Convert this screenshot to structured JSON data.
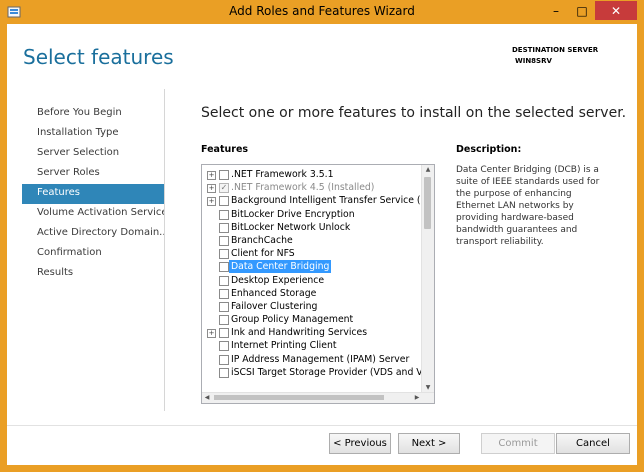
{
  "window": {
    "title": "Add Roles and Features Wizard"
  },
  "header": {
    "page_title": "Select features",
    "destination_label": "DESTINATION SERVER",
    "destination_server": "WIN8SRV"
  },
  "nav": {
    "items": [
      {
        "label": "Before You Begin",
        "active": false
      },
      {
        "label": "Installation Type",
        "active": false
      },
      {
        "label": "Server Selection",
        "active": false
      },
      {
        "label": "Server Roles",
        "active": false
      },
      {
        "label": "Features",
        "active": true
      },
      {
        "label": "Volume Activation Services",
        "active": false
      },
      {
        "label": "Active Directory Domain...",
        "active": false
      },
      {
        "label": "Confirmation",
        "active": false
      },
      {
        "label": "Results",
        "active": false
      }
    ]
  },
  "main": {
    "instruction": "Select one or more features to install on the selected server.",
    "features_label": "Features",
    "description_label": "Description:",
    "description_text": "Data Center Bridging (DCB) is a suite of IEEE standards used for the purpose of enhancing Ethernet LAN networks by providing hardware-based bandwidth guarantees and transport reliability.",
    "features": [
      {
        "label": ".NET Framework 3.5.1",
        "expandable": true,
        "checked": false,
        "installed": false
      },
      {
        "label": ".NET Framework 4.5 (Installed)",
        "expandable": true,
        "checked": true,
        "installed": true
      },
      {
        "label": "Background Intelligent Transfer Service (BIT",
        "expandable": true,
        "checked": false,
        "installed": false
      },
      {
        "label": "BitLocker Drive Encryption",
        "expandable": false,
        "checked": false,
        "installed": false
      },
      {
        "label": "BitLocker Network Unlock",
        "expandable": false,
        "checked": false,
        "installed": false
      },
      {
        "label": "BranchCache",
        "expandable": false,
        "checked": false,
        "installed": false
      },
      {
        "label": "Client for NFS",
        "expandable": false,
        "checked": false,
        "installed": false
      },
      {
        "label": "Data Center Bridging",
        "expandable": false,
        "checked": false,
        "installed": false,
        "selected": true
      },
      {
        "label": "Desktop Experience",
        "expandable": false,
        "checked": false,
        "installed": false
      },
      {
        "label": "Enhanced Storage",
        "expandable": false,
        "checked": false,
        "installed": false
      },
      {
        "label": "Failover Clustering",
        "expandable": false,
        "checked": false,
        "installed": false
      },
      {
        "label": "Group Policy Management",
        "expandable": false,
        "checked": false,
        "installed": false
      },
      {
        "label": "Ink and Handwriting Services",
        "expandable": true,
        "checked": false,
        "installed": false
      },
      {
        "label": "Internet Printing Client",
        "expandable": false,
        "checked": false,
        "installed": false
      },
      {
        "label": "IP Address Management (IPAM) Server",
        "expandable": false,
        "checked": false,
        "installed": false
      },
      {
        "label": "iSCSI Target Storage Provider (VDS and VSS",
        "expandable": false,
        "checked": false,
        "installed": false
      }
    ]
  },
  "buttons": {
    "previous": "< Previous",
    "next": "Next >",
    "commit": "Commit",
    "cancel": "Cancel"
  },
  "colors": {
    "titlebar": "#ea9f25",
    "nav_active": "#2f86b8",
    "page_title": "#1a6f9c",
    "selection": "#3399ff"
  }
}
